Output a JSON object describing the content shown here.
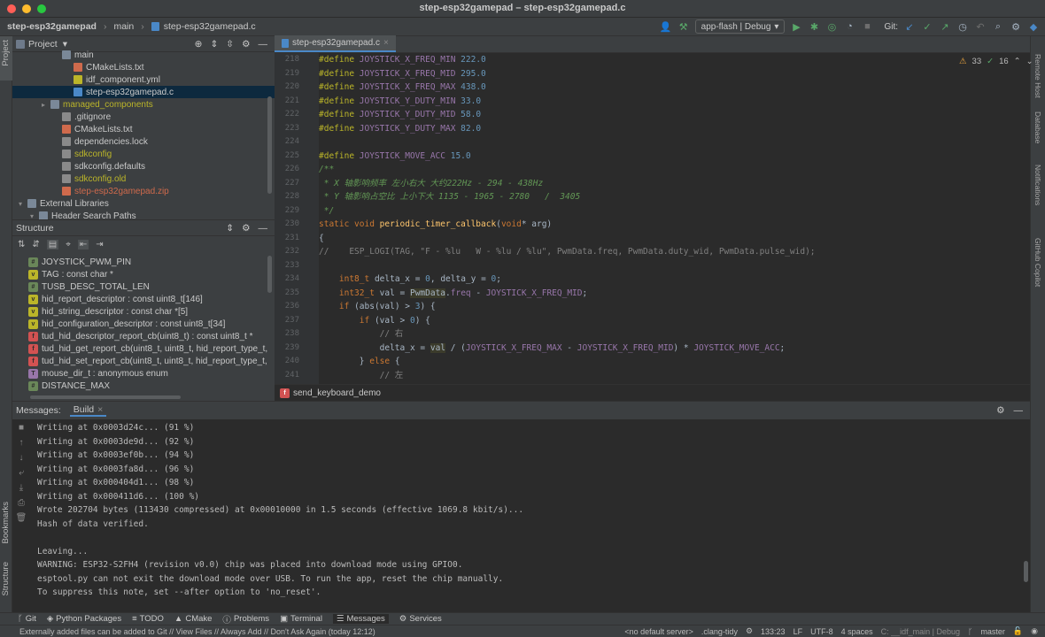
{
  "window": {
    "title": "step-esp32gamepad – step-esp32gamepad.c"
  },
  "breadcrumb": {
    "project": "step-esp32gamepad",
    "folder": "main",
    "file": "step-esp32gamepad.c"
  },
  "toolbar": {
    "run_config": "app-flash | Debug",
    "git_label": "Git:"
  },
  "project_panel": {
    "title": "Project",
    "tree": [
      {
        "label": "main",
        "indent": 4,
        "type": "folder",
        "color": "#c9c9c9"
      },
      {
        "label": "CMakeLists.txt",
        "indent": 5,
        "type": "cmake",
        "color": "#c9c9c9"
      },
      {
        "label": "idf_component.yml",
        "indent": 5,
        "type": "yml",
        "color": "#c9c9c9"
      },
      {
        "label": "step-esp32gamepad.c",
        "indent": 5,
        "type": "c",
        "color": "#c9c9c9",
        "selected": true
      },
      {
        "label": "managed_components",
        "indent": 3,
        "type": "folder",
        "color": "#bbb529",
        "arrow": true
      },
      {
        "label": ".gitignore",
        "indent": 4,
        "type": "git",
        "color": "#c9c9c9"
      },
      {
        "label": "CMakeLists.txt",
        "indent": 4,
        "type": "cmake",
        "color": "#c9c9c9"
      },
      {
        "label": "dependencies.lock",
        "indent": 4,
        "type": "file",
        "color": "#c9c9c9"
      },
      {
        "label": "sdkconfig",
        "indent": 4,
        "type": "file",
        "color": "#bbb529"
      },
      {
        "label": "sdkconfig.defaults",
        "indent": 4,
        "type": "file",
        "color": "#c9c9c9"
      },
      {
        "label": "sdkconfig.old",
        "indent": 4,
        "type": "file",
        "color": "#bbb529"
      },
      {
        "label": "step-esp32gamepad.zip",
        "indent": 4,
        "type": "zip",
        "color": "#cf6a4c"
      },
      {
        "label": "External Libraries",
        "indent": 1,
        "type": "lib",
        "color": "#c9c9c9",
        "arrow": true
      },
      {
        "label": "Header Search Paths",
        "indent": 2,
        "type": "lib",
        "color": "#c9c9c9",
        "arrow": true
      }
    ]
  },
  "structure_panel": {
    "title": "Structure",
    "items": [
      {
        "badge": "#",
        "color": "#6a8759",
        "label": "JOYSTICK_PWM_PIN"
      },
      {
        "badge": "v",
        "color": "#bbb529",
        "label": "TAG : const char *"
      },
      {
        "badge": "#",
        "color": "#6a8759",
        "label": "TUSB_DESC_TOTAL_LEN"
      },
      {
        "badge": "v",
        "color": "#bbb529",
        "label": "hid_report_descriptor : const uint8_t[146]"
      },
      {
        "badge": "v",
        "color": "#bbb529",
        "label": "hid_string_descriptor : const char *[5]"
      },
      {
        "badge": "v",
        "color": "#bbb529",
        "label": "hid_configuration_descriptor : const uint8_t[34]"
      },
      {
        "badge": "f",
        "color": "#d25252",
        "label": "tud_hid_descriptor_report_cb(uint8_t) : const uint8_t *"
      },
      {
        "badge": "f",
        "color": "#d25252",
        "label": "tud_hid_get_report_cb(uint8_t, uint8_t, hid_report_type_t,"
      },
      {
        "badge": "f",
        "color": "#d25252",
        "label": "tud_hid_set_report_cb(uint8_t, uint8_t, hid_report_type_t,"
      },
      {
        "badge": "T",
        "color": "#9876aa",
        "label": "mouse_dir_t : anonymous enum"
      },
      {
        "badge": "#",
        "color": "#6a8759",
        "label": "DISTANCE_MAX"
      }
    ]
  },
  "editor": {
    "tab": "step-esp32gamepad.c",
    "inspections": {
      "warnings": "33",
      "weak": "16"
    },
    "breadcrumb_fn": "send_keyboard_demo",
    "line_numbers": [
      "218",
      "219",
      "220",
      "221",
      "222",
      "223",
      "224",
      "225",
      "226",
      "227",
      "228",
      "229",
      "230",
      "231",
      "232",
      "233",
      "234",
      "235",
      "236",
      "237",
      "238",
      "239",
      "240",
      "241"
    ]
  },
  "messages": {
    "title": "Messages:",
    "tab": "Build",
    "lines": [
      "Writing at 0x0003d24c... (91 %)",
      "Writing at 0x0003de9d... (92 %)",
      "Writing at 0x0003ef0b... (94 %)",
      "Writing at 0x0003fa8d... (96 %)",
      "Writing at 0x000404d1... (98 %)",
      "Writing at 0x000411d6... (100 %)",
      "Wrote 202704 bytes (113430 compressed) at 0x00010000 in 1.5 seconds (effective 1069.8 kbit/s)...",
      "Hash of data verified.",
      "",
      "Leaving...",
      "WARNING: ESP32-S2FH4 (revision v0.0) chip was placed into download mode using GPIO0.",
      "esptool.py can not exit the download mode over USB. To run the app, reset the chip manually.",
      "To suppress this note, set --after option to 'no_reset'."
    ]
  },
  "side_tabs": {
    "left_top": "Project",
    "left_bm": "Bookmarks",
    "left_st": "Structure",
    "right": [
      "Remote Host",
      "Database",
      "Notifications",
      "GitHub Copilot"
    ]
  },
  "bottom_tabs": [
    "Git",
    "Python Packages",
    "TODO",
    "CMake",
    "Problems",
    "Terminal",
    "Messages",
    "Services"
  ],
  "status": {
    "message": "Externally added files can be added to Git // View Files // Always Add // Don't Ask Again (today 12:12)",
    "server": "<no default server>",
    "linter": ".clang-tidy",
    "position": "133:23",
    "eol": "LF",
    "encoding": "UTF-8",
    "indent": "4 spaces",
    "context": "C: __idf_main | Debug",
    "branch": "master"
  }
}
